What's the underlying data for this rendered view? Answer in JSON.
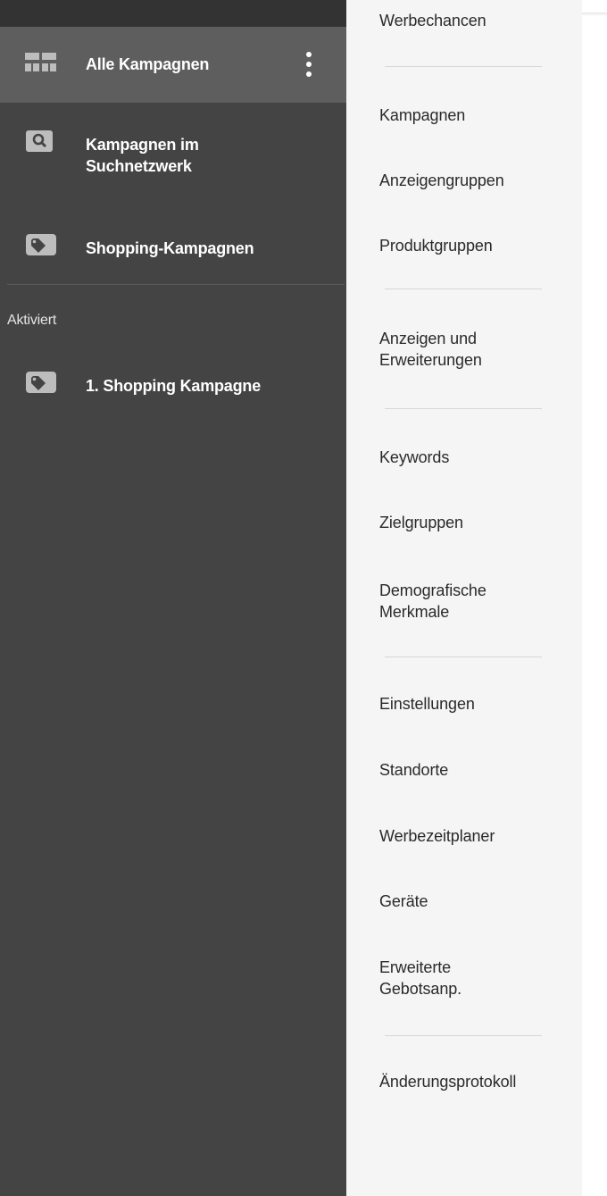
{
  "sidebar": {
    "items": [
      {
        "label": "Alle Kampagnen",
        "icon": "grid-view-icon",
        "active": true
      },
      {
        "label": "Kampagnen im\nSuchnetzwerk",
        "icon": "search-icon"
      },
      {
        "label": "Shopping-Kampagnen",
        "icon": "tag-icon"
      }
    ],
    "section_label": "Aktiviert",
    "campaigns": [
      {
        "label": "1. Shopping Kampagne",
        "icon": "tag-icon"
      }
    ]
  },
  "menu": {
    "items": [
      "Werbechancen",
      "Kampagnen",
      "Anzeigengruppen",
      "Produktgruppen",
      "Anzeigen und\nErweiterungen",
      "Keywords",
      "Zielgruppen",
      "Demografische\nMerkmale",
      "Einstellungen",
      "Standorte",
      "Werbezeitplaner",
      "Geräte",
      "Erweiterte\nGebotsanp.",
      "Änderungsprotokoll"
    ]
  },
  "colors": {
    "sidebar_bg": "#444444",
    "sidebar_active": "#5e5e5e",
    "menu_bg": "#f5f5f5",
    "icon_gray": "#bdbdbd"
  }
}
